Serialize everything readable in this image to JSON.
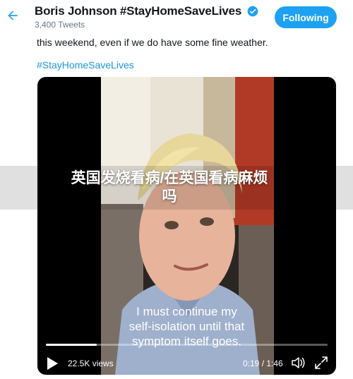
{
  "header": {
    "back_icon": "arrow-left-icon",
    "profile_name": "Boris Johnson #StayHomeSaveLives",
    "verified_icon": "verified-badge-icon",
    "tweet_count": "3,400 Tweets",
    "follow_label": "Following"
  },
  "tweet": {
    "text_line": "this weekend, even if we do have some fine weather.",
    "hashtag": "#StayHomeSaveLives"
  },
  "video": {
    "caption_line1": "I must continue my",
    "caption_line2": "self-isolation until that",
    "caption_line3": "symptom itself goes.",
    "views": "22.5K views",
    "timecode": "0:19 / 1:46",
    "progress_fraction": 0.18,
    "play_icon": "play-icon",
    "volume_icon": "volume-icon",
    "fullscreen_icon": "fullscreen-icon"
  },
  "overlay": {
    "line1": "英国发烧看病/在英国看病麻烦",
    "line2": "吗"
  },
  "colors": {
    "accent": "#1da1f2",
    "hashtag": "#1b95e0",
    "text": "#14171a",
    "muted": "#657786"
  }
}
